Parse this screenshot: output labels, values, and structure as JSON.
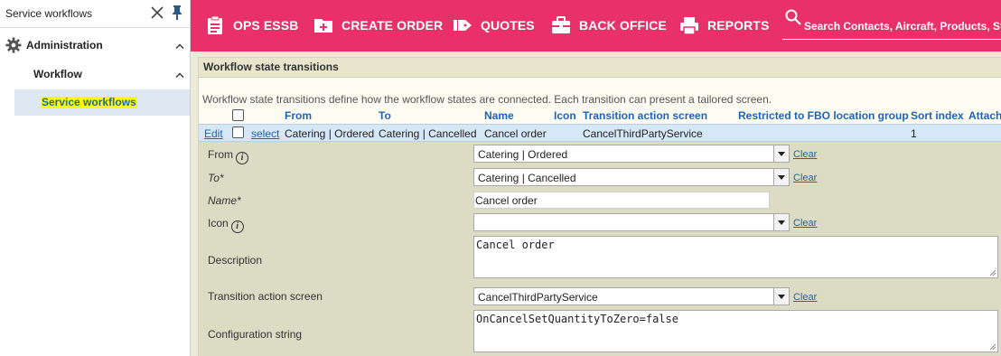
{
  "sidebar": {
    "search_text": "Service workflows",
    "admin_label": "Administration",
    "workflow_label": "Workflow",
    "service_label": "Service workflows"
  },
  "nav": {
    "items": [
      {
        "label": "OPS ESSB",
        "icon": "clipboard-icon"
      },
      {
        "label": "CREATE ORDER",
        "icon": "folder-plus-icon"
      },
      {
        "label": "QUOTES",
        "icon": "quote-tag-icon"
      },
      {
        "label": "BACK OFFICE",
        "icon": "briefcase-icon"
      },
      {
        "label": "REPORTS",
        "icon": "printer-icon"
      }
    ],
    "search_placeholder": "Search Contacts, Aircraft, Products, Stati"
  },
  "panel": {
    "title": "Workflow state transitions",
    "description": "Workflow state transitions define how the workflow states are connected. Each transition can present a tailored screen."
  },
  "table": {
    "headers": [
      "From",
      "To",
      "Name",
      "Icon",
      "Transition action screen",
      "Restricted to FBO location group",
      "Sort index",
      "Attach"
    ],
    "row": {
      "edit": "Edit",
      "select": "select",
      "from": "Catering | Ordered",
      "to": "Catering | Cancelled",
      "name": "Cancel order",
      "icon": "",
      "screen": "CancelThirdPartyService",
      "restricted": "",
      "sort": "1"
    }
  },
  "form": {
    "from_label": "From",
    "from_value": "Catering | Ordered",
    "to_label": "To*",
    "to_value": "Catering | Cancelled",
    "name_label": "Name*",
    "name_value": "Cancel order",
    "icon_label": "Icon",
    "icon_value": "",
    "description_label": "Description",
    "description_value": "Cancel order",
    "screen_label": "Transition action screen",
    "screen_value": "CancelThirdPartyService",
    "config_label": "Configuration string",
    "config_value": "OnCancelSetQuantityToZero=false",
    "clear_label": "Clear",
    "info_glyph": "i"
  },
  "colors": {
    "nav_bg": "#e8316b",
    "link": "#1e64b4",
    "highlight": "#ffff00",
    "selected_row": "#d6e7f5"
  }
}
